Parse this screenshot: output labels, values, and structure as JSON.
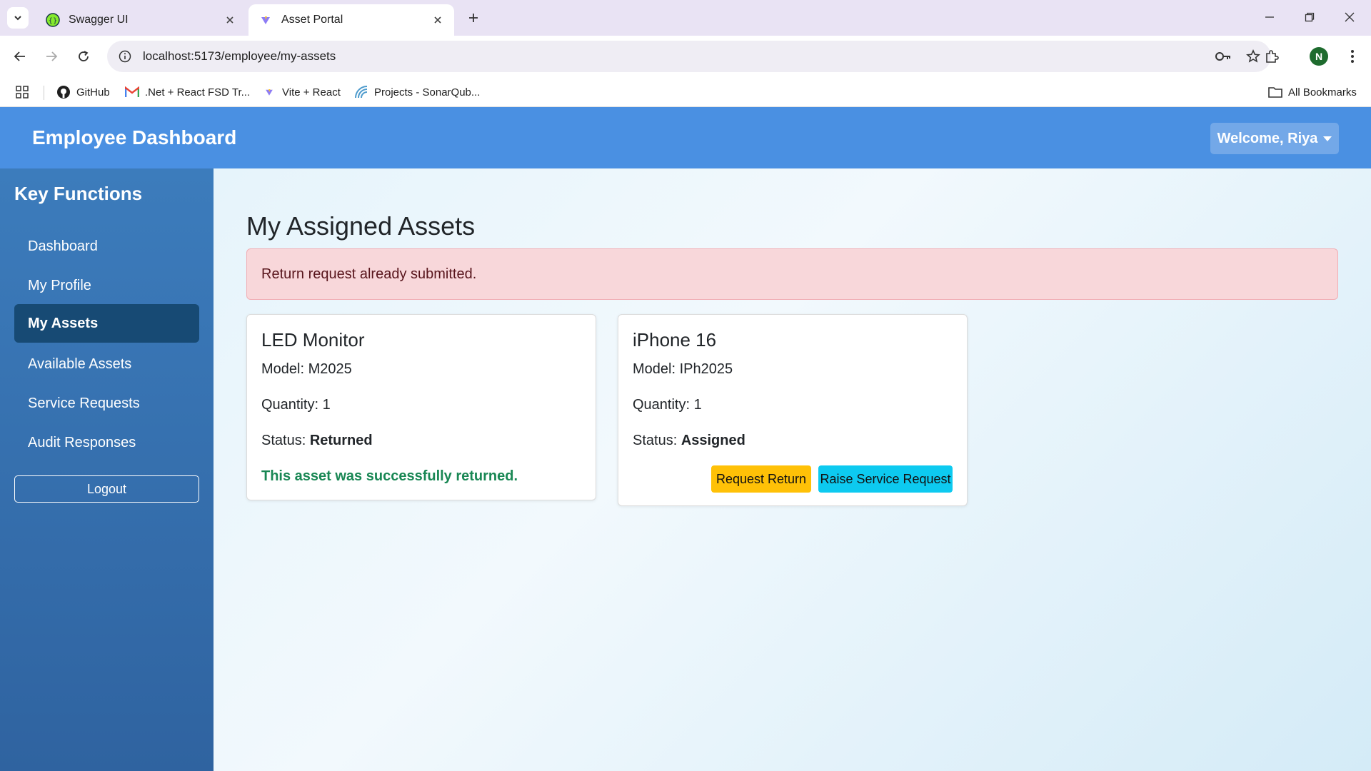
{
  "browser": {
    "tabs": [
      {
        "title": "Swagger UI",
        "active": false
      },
      {
        "title": "Asset Portal",
        "active": true
      }
    ],
    "url": "localhost:5173/employee/my-assets",
    "profile_initial": "N",
    "bookmarks": [
      {
        "label": "GitHub",
        "icon": "github-icon"
      },
      {
        "label": ".Net + React FSD Tr...",
        "icon": "gmail-icon"
      },
      {
        "label": "Vite + React",
        "icon": "vite-icon"
      },
      {
        "label": "Projects - SonarQub...",
        "icon": "sonarqube-icon"
      }
    ],
    "all_bookmarks_label": "All Bookmarks"
  },
  "header": {
    "title": "Employee Dashboard",
    "welcome_label": "Welcome, Riya",
    "accent_color": "#4a90e2"
  },
  "sidebar": {
    "title": "Key Functions",
    "items": [
      {
        "label": "Dashboard",
        "active": false
      },
      {
        "label": "My Profile",
        "active": false
      },
      {
        "label": "My Assets",
        "active": true
      },
      {
        "label": "Available Assets",
        "active": false
      },
      {
        "label": "Service Requests",
        "active": false
      },
      {
        "label": "Audit Responses",
        "active": false
      }
    ],
    "logout_label": "Logout"
  },
  "main": {
    "title": "My Assigned Assets",
    "alert": "Return request already submitted.",
    "assets": [
      {
        "name": "LED Monitor",
        "model_label": "Model: ",
        "model": "M2025",
        "quantity_label": "Quantity: ",
        "quantity": "1",
        "status_label": "Status: ",
        "status": "Returned",
        "note": "This asset was successfully returned."
      },
      {
        "name": "iPhone 16",
        "model_label": "Model: ",
        "model": "IPh2025",
        "quantity_label": "Quantity: ",
        "quantity": "1",
        "status_label": "Status: ",
        "status": "Assigned",
        "actions": {
          "request_return": "Request Return",
          "raise_service_request": "Raise Service Request"
        }
      }
    ]
  }
}
